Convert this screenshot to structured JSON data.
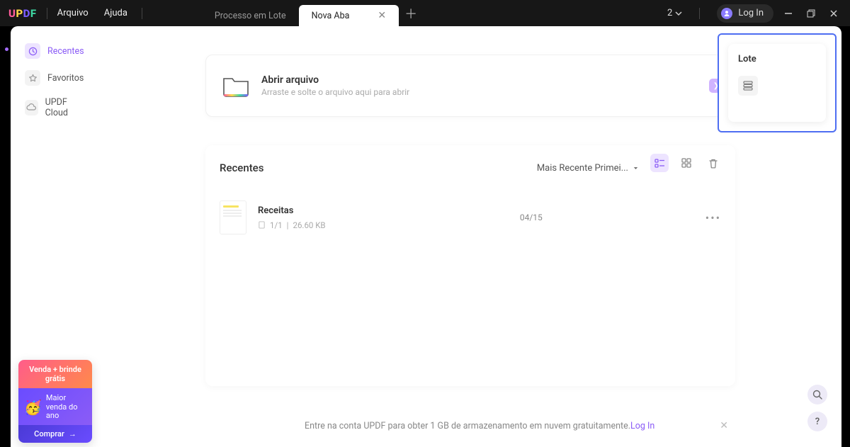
{
  "titlebar": {
    "logo": "UPDF",
    "menu": {
      "file": "Arquivo",
      "help": "Ajuda"
    },
    "tabs": [
      {
        "label": "Processo em Lote",
        "active": false
      },
      {
        "label": "Nova Aba",
        "active": true
      }
    ],
    "dropdown_num": "2",
    "login_label": "Log In"
  },
  "sidebar": {
    "items": [
      {
        "label": "Recentes",
        "icon": "clock-icon"
      },
      {
        "label": "Favoritos",
        "icon": "star-icon"
      },
      {
        "label": "UPDF Cloud",
        "icon": "cloud-icon"
      }
    ]
  },
  "open_card": {
    "title": "Abrir arquivo",
    "subtitle": "Arraste e solte o arquivo aqui para abrir"
  },
  "lote_panel": {
    "title": "Lote"
  },
  "recent": {
    "title": "Recentes",
    "sort_label": "Mais Recente Primei...",
    "files": [
      {
        "name": "Receitas",
        "pages": "1/1",
        "size": "26.60 KB",
        "date": "04/15"
      }
    ]
  },
  "promo": {
    "line1": "Venda + brinde grátis",
    "line2": "Maior venda do ano",
    "cta": "Comprar"
  },
  "footer": {
    "text": "Entre na conta UPDF para obter 1 GB de armazenamento em nuvem gratuitamente.",
    "link": "Log In"
  }
}
